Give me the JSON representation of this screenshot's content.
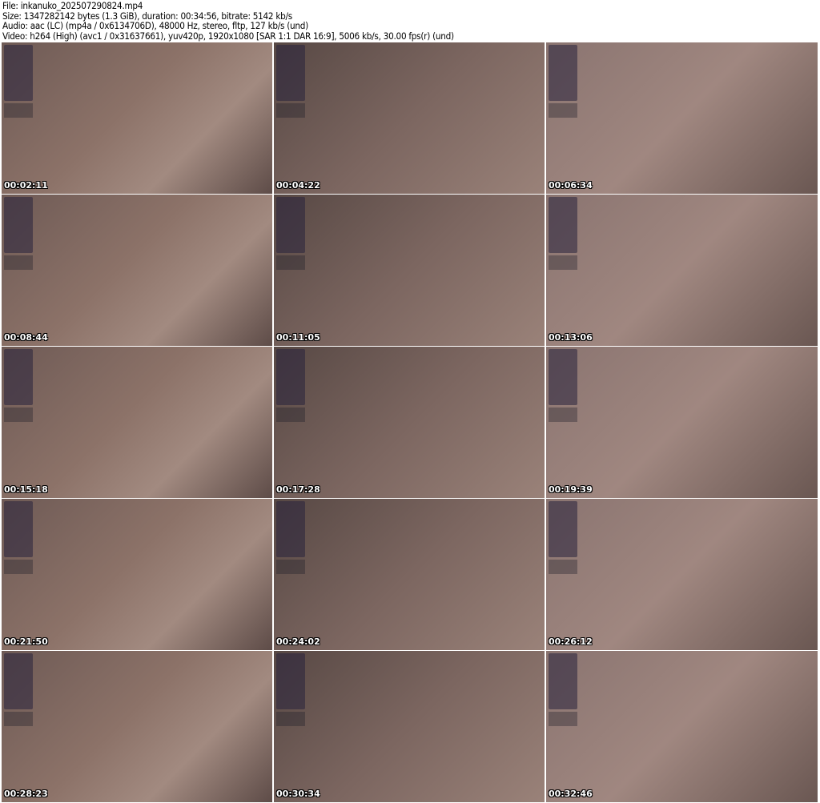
{
  "header": {
    "file": "File: inkanuko_202507290824.mp4",
    "size": "Size: 1347282142 bytes (1.3 GiB), duration: 00:34:56, bitrate: 5142 kb/s",
    "audio": "Audio: aac (LC) (mp4a / 0x6134706D), 48000 Hz, stereo, fltp, 127 kb/s (und)",
    "video": "Video: h264 (High) (avc1 / 0x31637661), yuv420p, 1920x1080 [SAR 1:1 DAR 16:9], 5006 kb/s, 30.00 fps(r) (und)"
  },
  "thumbnails": [
    {
      "timestamp": "00:02:11"
    },
    {
      "timestamp": "00:04:22"
    },
    {
      "timestamp": "00:06:34"
    },
    {
      "timestamp": "00:08:44"
    },
    {
      "timestamp": "00:11:05"
    },
    {
      "timestamp": "00:13:06"
    },
    {
      "timestamp": "00:15:18"
    },
    {
      "timestamp": "00:17:28"
    },
    {
      "timestamp": "00:19:39"
    },
    {
      "timestamp": "00:21:50"
    },
    {
      "timestamp": "00:24:02"
    },
    {
      "timestamp": "00:26:12"
    },
    {
      "timestamp": "00:28:23"
    },
    {
      "timestamp": "00:30:34"
    },
    {
      "timestamp": "00:32:46"
    }
  ]
}
